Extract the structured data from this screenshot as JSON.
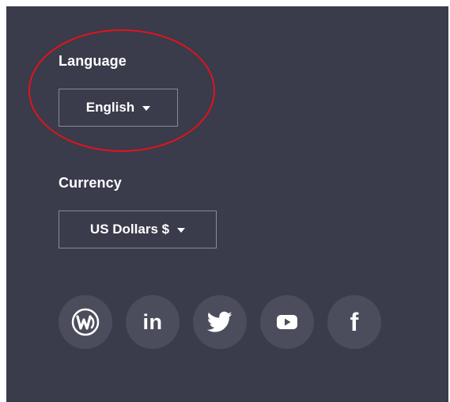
{
  "language": {
    "label": "Language",
    "selected": "English"
  },
  "currency": {
    "label": "Currency",
    "selected": "US Dollars $"
  },
  "social": [
    {
      "name": "wordpress-icon"
    },
    {
      "name": "linkedin-icon",
      "text": "in"
    },
    {
      "name": "twitter-icon"
    },
    {
      "name": "youtube-icon"
    },
    {
      "name": "facebook-icon",
      "text": "f"
    }
  ],
  "colors": {
    "panel": "#3a3b4b",
    "icon_bg": "#4c4d5c",
    "border": "#8a8b97",
    "annotation": "#e3131b"
  }
}
